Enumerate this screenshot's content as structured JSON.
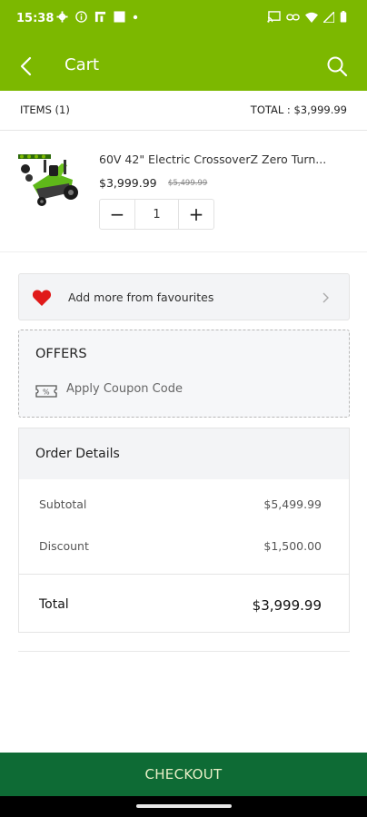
{
  "status_bar": {
    "time": "15:38",
    "left_icons": [
      "settings-icon",
      "info-icon",
      "app-icon",
      "square-icon",
      "dot-icon"
    ],
    "right_icons": [
      "cast-icon",
      "link-icon",
      "wifi-icon",
      "signal-icon",
      "battery-icon"
    ]
  },
  "app_bar": {
    "title": "Cart",
    "color": "#7cb800"
  },
  "summary": {
    "items_label": "ITEMS (1)",
    "total_label": "TOTAL : $3,999.99"
  },
  "cart_items": [
    {
      "name": "60V 42\" Electric CrossoverZ Zero Turn...",
      "price": "$3,999.99",
      "old_price": "$5,499.99",
      "quantity": "1",
      "decrement": "−",
      "increment": "+"
    }
  ],
  "favourites": {
    "label": "Add more from favourites"
  },
  "offers": {
    "title": "OFFERS",
    "coupon_label": "Apply Coupon Code"
  },
  "order_details": {
    "title": "Order Details",
    "rows": [
      {
        "label": "Subtotal",
        "value": "$5,499.99"
      },
      {
        "label": "Discount",
        "value": "$1,500.00"
      }
    ],
    "total_label": "Total",
    "total_value": "$3,999.99"
  },
  "checkout": {
    "label": "CHECKOUT",
    "color": "#0e6b35"
  }
}
